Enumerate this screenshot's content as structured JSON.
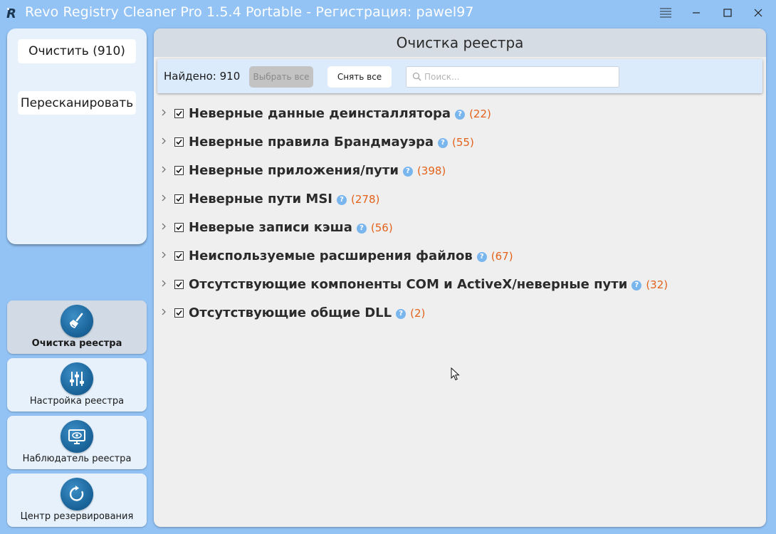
{
  "window": {
    "title": "Revo Registry Cleaner Pro 1.5.4 Portable - Регистрация: pawel97"
  },
  "left_panel": {
    "clean_label": "Очистить (910)",
    "rescan_label": "Пересканировать"
  },
  "nav": [
    {
      "label": "Очистка реестра",
      "icon": "broom-icon",
      "active": true
    },
    {
      "label": "Настройка реестра",
      "icon": "sliders-icon",
      "active": false
    },
    {
      "label": "Наблюдатель реестра",
      "icon": "monitor-eye-icon",
      "active": false
    },
    {
      "label": "Центр резервирования",
      "icon": "backup-refresh-icon",
      "active": false
    }
  ],
  "main": {
    "title": "Очистка реестра",
    "found_label": "Найдено: 910",
    "select_all_label": "Выбрать все",
    "deselect_all_label": "Снять все",
    "search_placeholder": "Поиск...",
    "items": [
      {
        "label": "Неверные данные деинсталлятора",
        "count": "(22)",
        "checked": true
      },
      {
        "label": "Неверные правила Брандмауэра",
        "count": "(55)",
        "checked": true
      },
      {
        "label": "Неверные приложения/пути",
        "count": "(398)",
        "checked": true
      },
      {
        "label": "Неверные пути MSI",
        "count": "(278)",
        "checked": true
      },
      {
        "label": "Неверые записи кэша",
        "count": "(56)",
        "checked": true
      },
      {
        "label": "Неиспользуемые расширения файлов",
        "count": "(67)",
        "checked": true
      },
      {
        "label": "Отсутствующие компоненты COM и ActiveX/неверные пути",
        "count": "(32)",
        "checked": true
      },
      {
        "label": "Отсутствующие общие DLL",
        "count": "(2)",
        "checked": true
      }
    ],
    "help_glyph": "?"
  },
  "colors": {
    "background": "#93c3f5",
    "panel": "#e6f1fc",
    "count": "#e3621c",
    "help": "#7ab6ee",
    "nav_icon": "#1e6aa1"
  }
}
